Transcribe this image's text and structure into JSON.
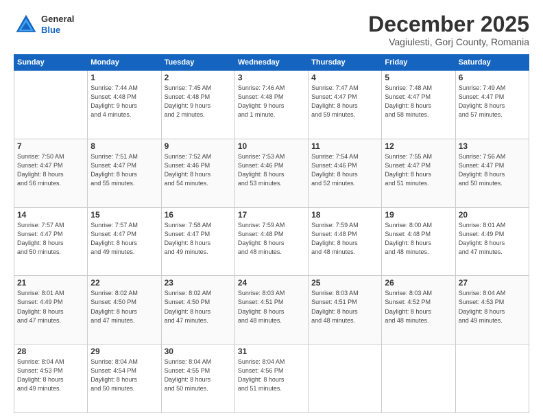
{
  "header": {
    "logo_line1": "General",
    "logo_line2": "Blue",
    "month": "December 2025",
    "location": "Vagiulesti, Gorj County, Romania"
  },
  "weekdays": [
    "Sunday",
    "Monday",
    "Tuesday",
    "Wednesday",
    "Thursday",
    "Friday",
    "Saturday"
  ],
  "weeks": [
    [
      {
        "day": "",
        "info": ""
      },
      {
        "day": "1",
        "info": "Sunrise: 7:44 AM\nSunset: 4:48 PM\nDaylight: 9 hours\nand 4 minutes."
      },
      {
        "day": "2",
        "info": "Sunrise: 7:45 AM\nSunset: 4:48 PM\nDaylight: 9 hours\nand 2 minutes."
      },
      {
        "day": "3",
        "info": "Sunrise: 7:46 AM\nSunset: 4:48 PM\nDaylight: 9 hours\nand 1 minute."
      },
      {
        "day": "4",
        "info": "Sunrise: 7:47 AM\nSunset: 4:47 PM\nDaylight: 8 hours\nand 59 minutes."
      },
      {
        "day": "5",
        "info": "Sunrise: 7:48 AM\nSunset: 4:47 PM\nDaylight: 8 hours\nand 58 minutes."
      },
      {
        "day": "6",
        "info": "Sunrise: 7:49 AM\nSunset: 4:47 PM\nDaylight: 8 hours\nand 57 minutes."
      }
    ],
    [
      {
        "day": "7",
        "info": "Sunrise: 7:50 AM\nSunset: 4:47 PM\nDaylight: 8 hours\nand 56 minutes."
      },
      {
        "day": "8",
        "info": "Sunrise: 7:51 AM\nSunset: 4:47 PM\nDaylight: 8 hours\nand 55 minutes."
      },
      {
        "day": "9",
        "info": "Sunrise: 7:52 AM\nSunset: 4:46 PM\nDaylight: 8 hours\nand 54 minutes."
      },
      {
        "day": "10",
        "info": "Sunrise: 7:53 AM\nSunset: 4:46 PM\nDaylight: 8 hours\nand 53 minutes."
      },
      {
        "day": "11",
        "info": "Sunrise: 7:54 AM\nSunset: 4:46 PM\nDaylight: 8 hours\nand 52 minutes."
      },
      {
        "day": "12",
        "info": "Sunrise: 7:55 AM\nSunset: 4:47 PM\nDaylight: 8 hours\nand 51 minutes."
      },
      {
        "day": "13",
        "info": "Sunrise: 7:56 AM\nSunset: 4:47 PM\nDaylight: 8 hours\nand 50 minutes."
      }
    ],
    [
      {
        "day": "14",
        "info": "Sunrise: 7:57 AM\nSunset: 4:47 PM\nDaylight: 8 hours\nand 50 minutes."
      },
      {
        "day": "15",
        "info": "Sunrise: 7:57 AM\nSunset: 4:47 PM\nDaylight: 8 hours\nand 49 minutes."
      },
      {
        "day": "16",
        "info": "Sunrise: 7:58 AM\nSunset: 4:47 PM\nDaylight: 8 hours\nand 49 minutes."
      },
      {
        "day": "17",
        "info": "Sunrise: 7:59 AM\nSunset: 4:48 PM\nDaylight: 8 hours\nand 48 minutes."
      },
      {
        "day": "18",
        "info": "Sunrise: 7:59 AM\nSunset: 4:48 PM\nDaylight: 8 hours\nand 48 minutes."
      },
      {
        "day": "19",
        "info": "Sunrise: 8:00 AM\nSunset: 4:48 PM\nDaylight: 8 hours\nand 48 minutes."
      },
      {
        "day": "20",
        "info": "Sunrise: 8:01 AM\nSunset: 4:49 PM\nDaylight: 8 hours\nand 47 minutes."
      }
    ],
    [
      {
        "day": "21",
        "info": "Sunrise: 8:01 AM\nSunset: 4:49 PM\nDaylight: 8 hours\nand 47 minutes."
      },
      {
        "day": "22",
        "info": "Sunrise: 8:02 AM\nSunset: 4:50 PM\nDaylight: 8 hours\nand 47 minutes."
      },
      {
        "day": "23",
        "info": "Sunrise: 8:02 AM\nSunset: 4:50 PM\nDaylight: 8 hours\nand 47 minutes."
      },
      {
        "day": "24",
        "info": "Sunrise: 8:03 AM\nSunset: 4:51 PM\nDaylight: 8 hours\nand 48 minutes."
      },
      {
        "day": "25",
        "info": "Sunrise: 8:03 AM\nSunset: 4:51 PM\nDaylight: 8 hours\nand 48 minutes."
      },
      {
        "day": "26",
        "info": "Sunrise: 8:03 AM\nSunset: 4:52 PM\nDaylight: 8 hours\nand 48 minutes."
      },
      {
        "day": "27",
        "info": "Sunrise: 8:04 AM\nSunset: 4:53 PM\nDaylight: 8 hours\nand 49 minutes."
      }
    ],
    [
      {
        "day": "28",
        "info": "Sunrise: 8:04 AM\nSunset: 4:53 PM\nDaylight: 8 hours\nand 49 minutes."
      },
      {
        "day": "29",
        "info": "Sunrise: 8:04 AM\nSunset: 4:54 PM\nDaylight: 8 hours\nand 50 minutes."
      },
      {
        "day": "30",
        "info": "Sunrise: 8:04 AM\nSunset: 4:55 PM\nDaylight: 8 hours\nand 50 minutes."
      },
      {
        "day": "31",
        "info": "Sunrise: 8:04 AM\nSunset: 4:56 PM\nDaylight: 8 hours\nand 51 minutes."
      },
      {
        "day": "",
        "info": ""
      },
      {
        "day": "",
        "info": ""
      },
      {
        "day": "",
        "info": ""
      }
    ]
  ]
}
